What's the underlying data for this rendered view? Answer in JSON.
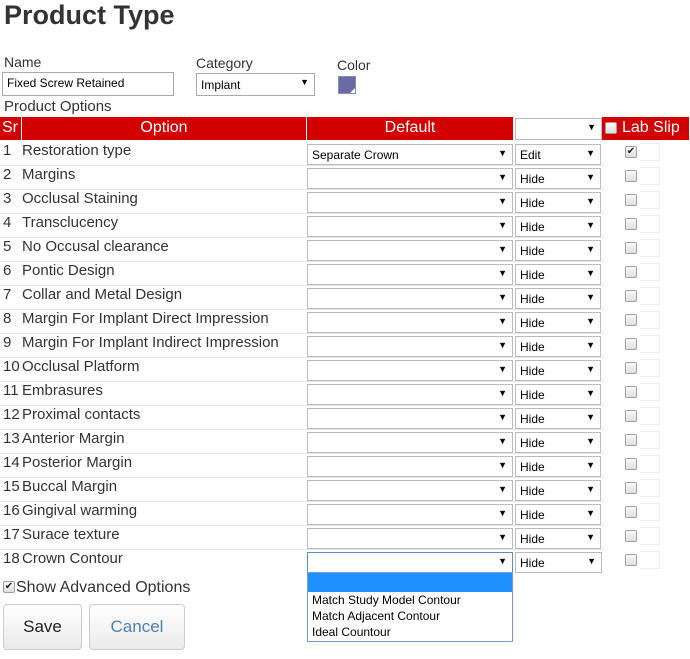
{
  "page_title": "Product Type",
  "name_field": {
    "label": "Name",
    "value": "Fixed Screw Retained"
  },
  "category_field": {
    "label": "Category",
    "value": "Implant"
  },
  "color_field": {
    "label": "Color",
    "value": "#6b6ba3"
  },
  "options_section": {
    "label": "Product Options"
  },
  "table": {
    "headers": {
      "sr": "Sr",
      "option": "Option",
      "default": "Default",
      "lab_slip": "Lab Slip"
    },
    "header_select_value": "",
    "header_color": "#d20000",
    "rows": [
      {
        "sr": "1",
        "option": "Restoration type",
        "default": "Separate Crown",
        "visibility": "Edit",
        "lab_slip": true
      },
      {
        "sr": "2",
        "option": "Margins",
        "default": "",
        "visibility": "Hide",
        "lab_slip": false
      },
      {
        "sr": "3",
        "option": "Occlusal Staining",
        "default": "",
        "visibility": "Hide",
        "lab_slip": false
      },
      {
        "sr": "4",
        "option": "Transclucency",
        "default": "",
        "visibility": "Hide",
        "lab_slip": false
      },
      {
        "sr": "5",
        "option": "No Occusal clearance",
        "default": "",
        "visibility": "Hide",
        "lab_slip": false
      },
      {
        "sr": "6",
        "option": "Pontic Design",
        "default": "",
        "visibility": "Hide",
        "lab_slip": false
      },
      {
        "sr": "7",
        "option": "Collar and Metal Design",
        "default": "",
        "visibility": "Hide",
        "lab_slip": false
      },
      {
        "sr": "8",
        "option": "Margin For Implant Direct Impression",
        "default": "",
        "visibility": "Hide",
        "lab_slip": false
      },
      {
        "sr": "9",
        "option": "Margin For Implant Indirect Impression",
        "default": "",
        "visibility": "Hide",
        "lab_slip": false
      },
      {
        "sr": "10",
        "option": "Occlusal Platform",
        "default": "",
        "visibility": "Hide",
        "lab_slip": false
      },
      {
        "sr": "11",
        "option": "Embrasures",
        "default": "",
        "visibility": "Hide",
        "lab_slip": false
      },
      {
        "sr": "12",
        "option": "Proximal contacts",
        "default": "",
        "visibility": "Hide",
        "lab_slip": false
      },
      {
        "sr": "13",
        "option": "Anterior Margin",
        "default": "",
        "visibility": "Hide",
        "lab_slip": false
      },
      {
        "sr": "14",
        "option": "Posterior Margin",
        "default": "",
        "visibility": "Hide",
        "lab_slip": false
      },
      {
        "sr": "15",
        "option": "Buccal Margin",
        "default": "",
        "visibility": "Hide",
        "lab_slip": false
      },
      {
        "sr": "16",
        "option": "Gingival warming",
        "default": "",
        "visibility": "Hide",
        "lab_slip": false
      },
      {
        "sr": "17",
        "option": "Surace texture",
        "default": "",
        "visibility": "Hide",
        "lab_slip": false
      },
      {
        "sr": "18",
        "option": "Crown Contour",
        "default": "",
        "visibility": "Hide",
        "lab_slip": false
      }
    ]
  },
  "open_dropdown": {
    "options": [
      "",
      "Match Study Model Contour",
      "Match Adjacent Contour",
      "Ideal Countour"
    ],
    "highlighted_index": 0
  },
  "show_advanced": {
    "label": "Show Advanced Options",
    "checked": true
  },
  "buttons": {
    "save": "Save",
    "cancel": "Cancel"
  }
}
